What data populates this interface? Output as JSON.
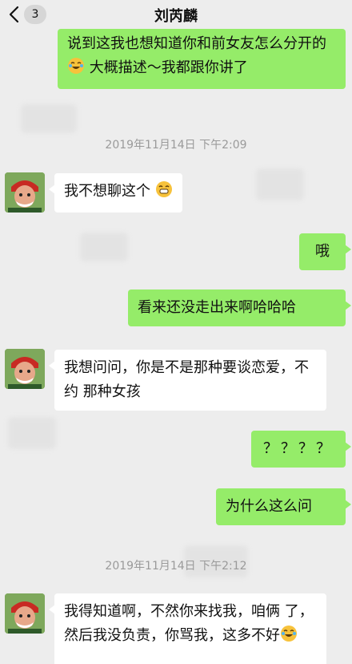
{
  "header": {
    "back_icon": "chevron-left-icon",
    "unread_count": "3",
    "title": "刘芮麟"
  },
  "messages": [
    {
      "side": "out",
      "text_before": "说到这我也想知道你和前女友怎么分开的",
      "emoji": "tears-of-joy-emoji",
      "text_after": " 大概描述～我都跟你讲了"
    },
    {
      "type": "timestamp",
      "text": "2019年11月14日 下午2:09"
    },
    {
      "side": "in",
      "text": "我不想聊这个",
      "emoji": "grinning-emoji"
    },
    {
      "side": "out",
      "text": "哦"
    },
    {
      "side": "out",
      "text": "看来还没走出来啊哈哈哈"
    },
    {
      "side": "in",
      "text": "我想问问，你是不是那种要谈恋爱，不约 那种女孩"
    },
    {
      "side": "out",
      "text": "？？？？"
    },
    {
      "side": "out",
      "text": "为什么这么问"
    },
    {
      "type": "timestamp",
      "text": "2019年11月14日 下午2:12"
    },
    {
      "side": "in",
      "text_before": "我得知道啊，不然你来找我，咱俩 了，然后我没负责，你骂我，这多不好",
      "emoji": "tears-of-joy-emoji"
    }
  ],
  "colors": {
    "background": "#ededed",
    "outgoing_bubble": "#95ec69",
    "incoming_bubble": "#ffffff",
    "timestamp_text": "#9a9a9a",
    "unread_badge": "#d6d6d6"
  }
}
